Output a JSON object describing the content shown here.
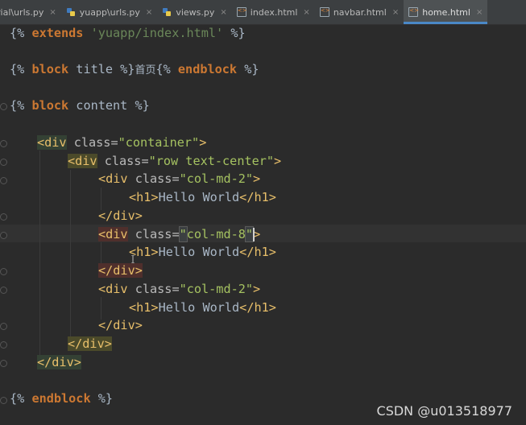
{
  "tabs": [
    {
      "name": "rial\\urls.py",
      "type": "py",
      "active": false
    },
    {
      "name": "yuapp\\urls.py",
      "type": "py",
      "active": false
    },
    {
      "name": "views.py",
      "type": "py",
      "active": false
    },
    {
      "name": "index.html",
      "type": "html",
      "active": false
    },
    {
      "name": "navbar.html",
      "type": "html",
      "active": false
    },
    {
      "name": "home.html",
      "type": "html",
      "active": true
    }
  ],
  "close_glyph": "×",
  "code": {
    "l1": {
      "open": "{% ",
      "kw": "extends",
      "sp": " ",
      "str": "'yuapp/index.html'",
      "close": " %}"
    },
    "l2": {
      "open": "{% ",
      "kw": "block",
      "mid": " title %}",
      "cn": "首页",
      "open2": "{% ",
      "kw2": "endblock",
      "close": " %}"
    },
    "l3": {
      "open": "{% ",
      "kw": "block",
      "rest": " content %}"
    },
    "div_open": "<div",
    "div_close": "</div>",
    "h1_open": "<h1>",
    "h1_close": "</h1>",
    "gt": ">",
    "class_attr": " class=",
    "val_container": "\"container\"",
    "val_row": "\"row text-center\"",
    "val_col2": "\"col-md-2\"",
    "val_col8_q1": "\"",
    "val_col8": "col-md-8",
    "val_col8_q2": "\"",
    "hello": "Hello World",
    "endblock": {
      "open": "{% ",
      "kw": "endblock",
      "close": " %}"
    }
  },
  "watermark": "CSDN @u013518977"
}
